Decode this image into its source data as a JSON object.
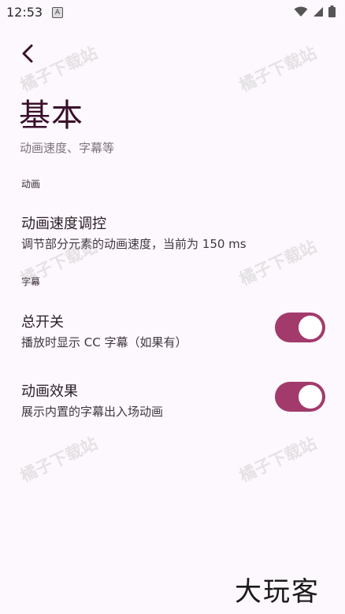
{
  "status_bar": {
    "time": "12:53",
    "notification_badge": "A",
    "icons": [
      "wifi-icon",
      "signal-icon",
      "battery-icon"
    ]
  },
  "header": {
    "back_icon": "chevron-left-icon",
    "title": "基本",
    "subtitle": "动画速度、字幕等"
  },
  "sections": {
    "animation": {
      "header": "动画",
      "speed_item": {
        "title": "动画速度调控",
        "summary": "调节部分元素的动画速度，当前为 150 ms"
      }
    },
    "subtitles": {
      "header": "字幕",
      "master_switch": {
        "title": "总开关",
        "summary": "播放时显示 CC 字幕（如果有）",
        "checked": true
      },
      "animation_effect": {
        "title": "动画效果",
        "summary": "展示内置的字幕出入场动画",
        "checked": true
      }
    }
  },
  "watermark": "橘子下载站",
  "logo_text": "大玩客",
  "colors": {
    "accent": "#a23b6c",
    "title": "#3a0f2b",
    "background": "#fdf8fd"
  }
}
